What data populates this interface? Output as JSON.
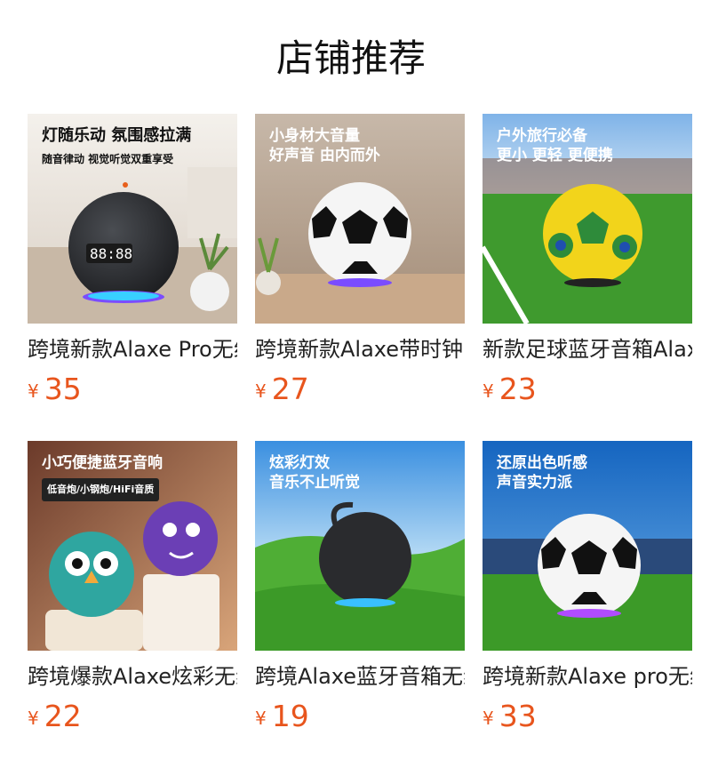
{
  "header": {
    "title": "店铺推荐"
  },
  "products": [
    {
      "name": "跨境新款Alaxe Pro无线",
      "currency": "¥",
      "price": "35",
      "image_text": [
        "灯随乐动 氛围感拉满"
      ],
      "image_sub": "随音律动 视觉听觉双重享受",
      "image_tag": "",
      "clock": "88:88"
    },
    {
      "name": "跨境新款Alaxe带时钟",
      "currency": "¥",
      "price": "27",
      "image_text": [
        "小身材大音量",
        "好声音 由内而外"
      ],
      "image_sub": "",
      "image_tag": "",
      "clock": ""
    },
    {
      "name": "新款足球蓝牙音箱Alaxe",
      "currency": "¥",
      "price": "23",
      "image_text": [
        "户外旅行必备",
        "更小 更轻 更便携"
      ],
      "image_sub": "",
      "image_tag": "",
      "clock": ""
    },
    {
      "name": "跨境爆款Alaxe炫彩无线",
      "currency": "¥",
      "price": "22",
      "image_text": [
        "小巧便捷蓝牙音响"
      ],
      "image_sub": "",
      "image_tag": "低音炮/小钢炮/HiFi音质",
      "clock": ""
    },
    {
      "name": "跨境Alaxe蓝牙音箱无线",
      "currency": "¥",
      "price": "19",
      "image_text": [
        "炫彩灯效",
        "音乐不止听觉"
      ],
      "image_sub": "",
      "image_tag": "",
      "clock": ""
    },
    {
      "name": "跨境新款Alaxe pro无线",
      "currency": "¥",
      "price": "33",
      "image_text": [
        "还原出色听感",
        "声音实力派"
      ],
      "image_sub": "",
      "image_tag": "",
      "clock": ""
    }
  ]
}
